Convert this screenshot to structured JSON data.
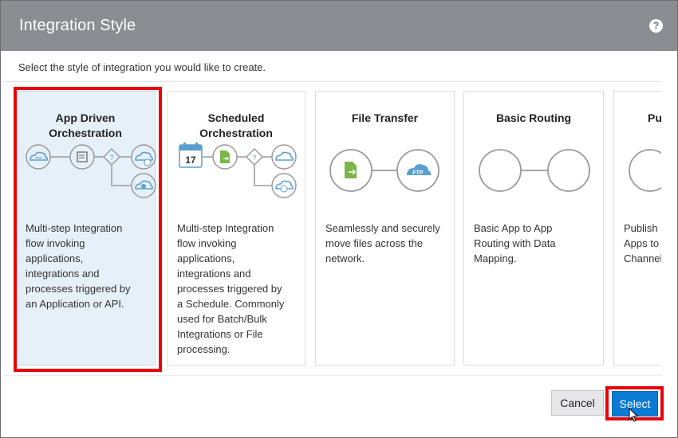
{
  "dialog": {
    "title": "Integration Style",
    "help_icon": "?",
    "instruction": "Select the style of integration you would like to create."
  },
  "cards": [
    {
      "title_line1": "App Driven",
      "title_line2": "Orchestration",
      "desc": [
        "Multi-step Integration",
        "flow invoking",
        "applications,",
        "integrations and",
        "processes triggered by",
        "an Application or API."
      ],
      "selected": true
    },
    {
      "title_line1": "Scheduled",
      "title_line2": "Orchestration",
      "calendar_day": "17",
      "desc": [
        "Multi-step Integration",
        "flow invoking",
        "applications,",
        "integrations and",
        "processes triggered by",
        "a Schedule. Commonly",
        "used for Batch/Bulk",
        "Integrations or File",
        "processing."
      ],
      "selected": false
    },
    {
      "title_line1": "File Transfer",
      "title_line2": "",
      "ftp_label": "FTP",
      "desc": [
        "Seamlessly and securely",
        "move files across the",
        "network."
      ],
      "selected": false
    },
    {
      "title_line1": "Basic Routing",
      "title_line2": "",
      "desc": [
        "Basic App to App",
        "Routing with Data",
        "Mapping."
      ],
      "selected": false
    },
    {
      "title_line1": "Publi",
      "title_line2": "",
      "desc": [
        "Publish",
        "Apps to",
        "Channel"
      ],
      "selected": false
    }
  ],
  "buttons": {
    "cancel_label": "Cancel",
    "select_label": "Select"
  },
  "colors": {
    "header_bg": "#8c8c93",
    "selected_card_bg": "#e6f0f8",
    "highlight_red": "#e8000b",
    "primary_blue": "#0a7ad2",
    "icon_blue": "#5a9fd0",
    "icon_green": "#7ab648",
    "icon_gray": "#9a9a9a"
  },
  "icons": [
    "help-icon",
    "cloud-icon",
    "document-icon",
    "decision-icon",
    "calendar-icon",
    "ftp-cloud-icon",
    "cursor-icon"
  ]
}
